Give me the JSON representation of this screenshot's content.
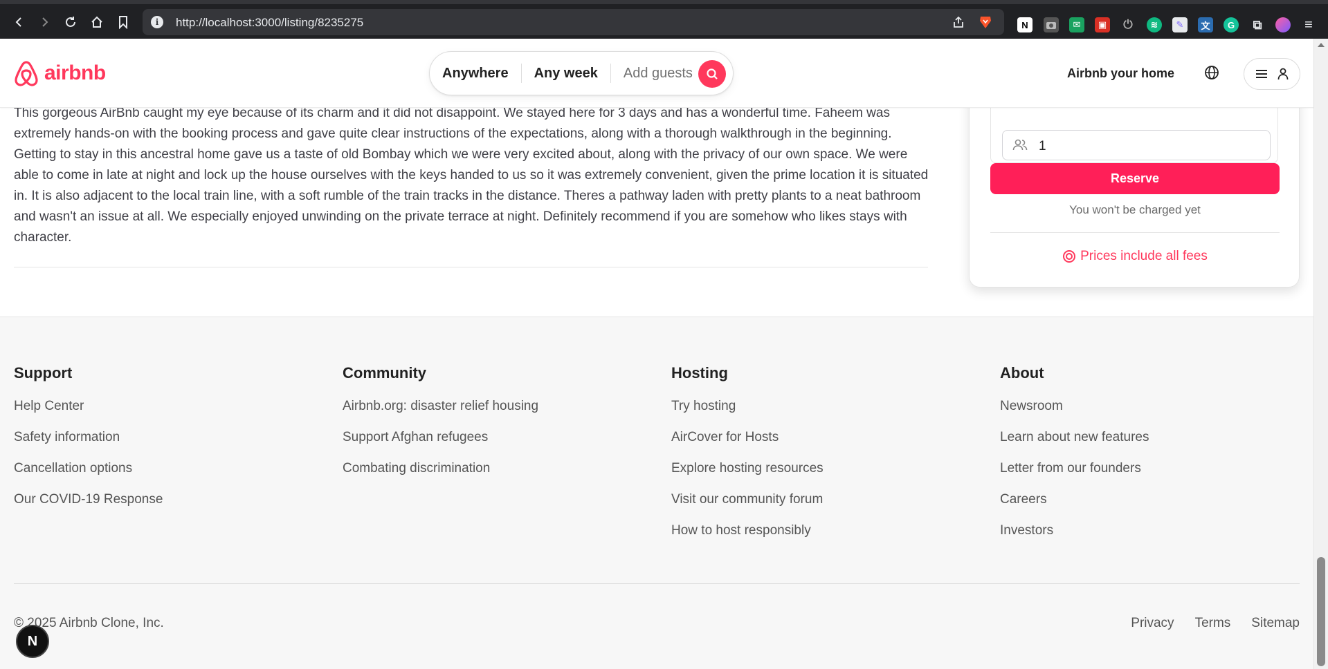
{
  "browser": {
    "url": "http://localhost:3000/listing/8235275"
  },
  "header": {
    "logo_text": "airbnb",
    "search": {
      "where": "Anywhere",
      "when": "Any week",
      "guests": "Add guests"
    },
    "host_link": "Airbnb your home"
  },
  "review": {
    "text": "This gorgeous AirBnb caught my eye because of its charm and it did not disappoint. We stayed here for 3 days and has a wonderful time. Faheem was extremely hands-on with the booking process and gave quite clear instructions of the expectations, along with a thorough walkthrough in the beginning. Getting to stay in this ancestral home gave us a taste of old Bombay which we were very excited about, along with the privacy of our own space. We were able to come in late at night and lock up the house ourselves with the keys handed to us so it was extremely convenient, given the prime location it is situated in. It is also adjacent to the local train line, with a soft rumble of the train tracks in the distance. Theres a pathway laden with pretty plants to a neat bathroom and wasn't an issue at all. We especially enjoyed unwinding on the private terrace at night. Definitely recommend if you are somehow who likes stays with character."
  },
  "booking": {
    "guests_value": "1",
    "reserve_label": "Reserve",
    "charge_note": "You won't be charged yet",
    "fees_label": "Prices include all fees"
  },
  "footer": {
    "columns": [
      {
        "title": "Support",
        "links": [
          "Help Center",
          "Safety information",
          "Cancellation options",
          "Our COVID-19 Response"
        ]
      },
      {
        "title": "Community",
        "links": [
          "Airbnb.org: disaster relief housing",
          "Support Afghan refugees",
          "Combating discrimination"
        ]
      },
      {
        "title": "Hosting",
        "links": [
          "Try hosting",
          "AirCover for Hosts",
          "Explore hosting resources",
          "Visit our community forum",
          "How to host responsibly"
        ]
      },
      {
        "title": "About",
        "links": [
          "Newsroom",
          "Learn about new features",
          "Letter from our founders",
          "Careers",
          "Investors"
        ]
      }
    ],
    "copyright": "© 2025 Airbnb Clone, Inc.",
    "legal": [
      "Privacy",
      "Terms",
      "Sitemap"
    ]
  },
  "dev_badge": "N",
  "colors": {
    "brand": "#ff385c",
    "reserve": "#ff1f58"
  }
}
